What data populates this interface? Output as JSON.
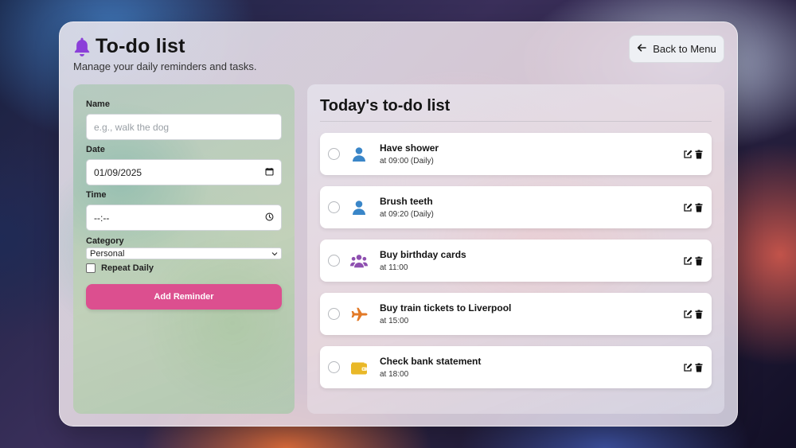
{
  "header": {
    "title": "To-do list",
    "subtitle": "Manage your daily reminders and tasks.",
    "back_label": "Back to Menu"
  },
  "form": {
    "name_label": "Name",
    "name_placeholder": "e.g., walk the dog",
    "date_label": "Date",
    "date_value": "01/09/2025",
    "time_label": "Time",
    "time_value": "--:--",
    "category_label": "Category",
    "category_value": "Personal",
    "repeat_label": "Repeat Daily",
    "add_label": "Add Reminder"
  },
  "list": {
    "title": "Today's to-do list",
    "tasks": [
      {
        "name": "Have shower",
        "meta": "at 09:00 (Daily)",
        "icon": "person-icon",
        "color": "#3a86c8"
      },
      {
        "name": "Brush teeth",
        "meta": "at 09:20 (Daily)",
        "icon": "person-icon",
        "color": "#3a86c8"
      },
      {
        "name": "Buy birthday cards",
        "meta": "at 11:00",
        "icon": "group-icon",
        "color": "#8e4fb0"
      },
      {
        "name": "Buy train tickets to Liverpool",
        "meta": "at 15:00",
        "icon": "plane-icon",
        "color": "#e27a28"
      },
      {
        "name": "Check bank statement",
        "meta": "at 18:00",
        "icon": "wallet-icon",
        "color": "#e9b828"
      }
    ]
  },
  "colors": {
    "accent": "#dc4f8f",
    "bell": "#8b3fd9"
  }
}
